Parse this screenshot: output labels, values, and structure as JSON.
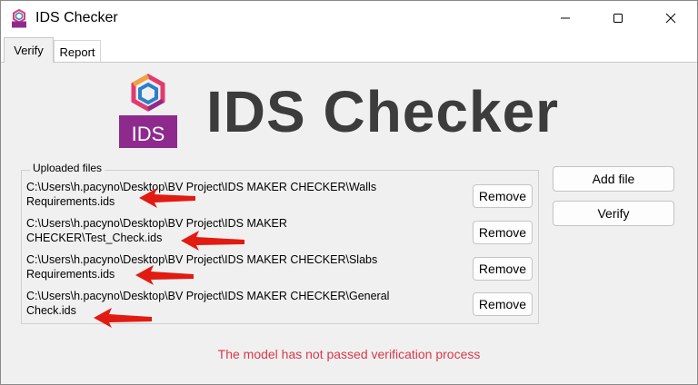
{
  "window": {
    "title": "IDS Checker"
  },
  "tabs": [
    {
      "label": "Verify"
    },
    {
      "label": "Report"
    }
  ],
  "header": {
    "logo_text": "IDS",
    "title": "IDS Checker"
  },
  "uploaded_files": {
    "label": "Uploaded files",
    "items": [
      {
        "line1": "C:\\Users\\h.pacyno\\Desktop\\BV Project\\IDS MAKER  CHECKER\\Walls",
        "line2": "Requirements.ids",
        "remove_label": "Remove"
      },
      {
        "line1": "C:\\Users\\h.pacyno\\Desktop\\BV Project\\IDS MAKER",
        "line2": "CHECKER\\Test_Check.ids",
        "remove_label": "Remove"
      },
      {
        "line1": "C:\\Users\\h.pacyno\\Desktop\\BV Project\\IDS MAKER  CHECKER\\Slabs",
        "line2": "Requirements.ids",
        "remove_label": "Remove"
      },
      {
        "line1": "C:\\Users\\h.pacyno\\Desktop\\BV Project\\IDS MAKER  CHECKER\\General",
        "line2": "Check.ids",
        "remove_label": "Remove"
      }
    ]
  },
  "actions": {
    "add_file": "Add file",
    "verify": "Verify"
  },
  "status": {
    "message": "The model has not passed verification process",
    "color": "#d63a4a"
  },
  "colors": {
    "brand_purple": "#8e2a8e",
    "annotation_arrow": "#e11b12"
  }
}
